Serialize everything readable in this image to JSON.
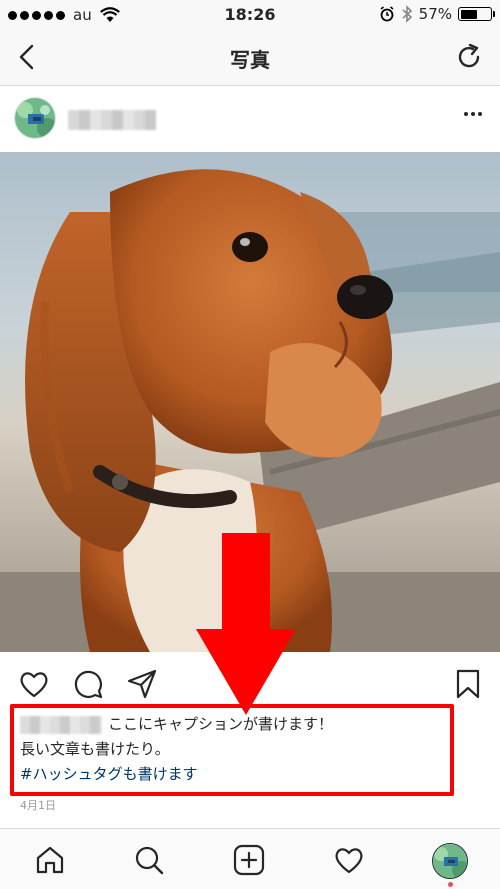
{
  "status_bar": {
    "carrier": "au",
    "time": "18:26",
    "battery_text": "57%",
    "battery_level": 0.57
  },
  "nav": {
    "title": "写真"
  },
  "post": {
    "caption_line1": "ここにキャプションが書けます！",
    "caption_line2": "長い文章も書けたり。",
    "hashtag_line": "#ハッシュタグも書けます",
    "date": "4月1日"
  },
  "icons": {
    "back": "chevron-left-icon",
    "refresh": "refresh-icon",
    "more": "more-icon",
    "like": "heart-icon",
    "comment": "comment-icon",
    "share": "send-icon",
    "save": "bookmark-icon",
    "home": "home-icon",
    "search": "search-icon",
    "add": "add-icon",
    "activity": "heart-icon"
  },
  "colors": {
    "highlight": "#ff0000",
    "hashtag": "#003569",
    "notification_dot": "#ed4956"
  }
}
